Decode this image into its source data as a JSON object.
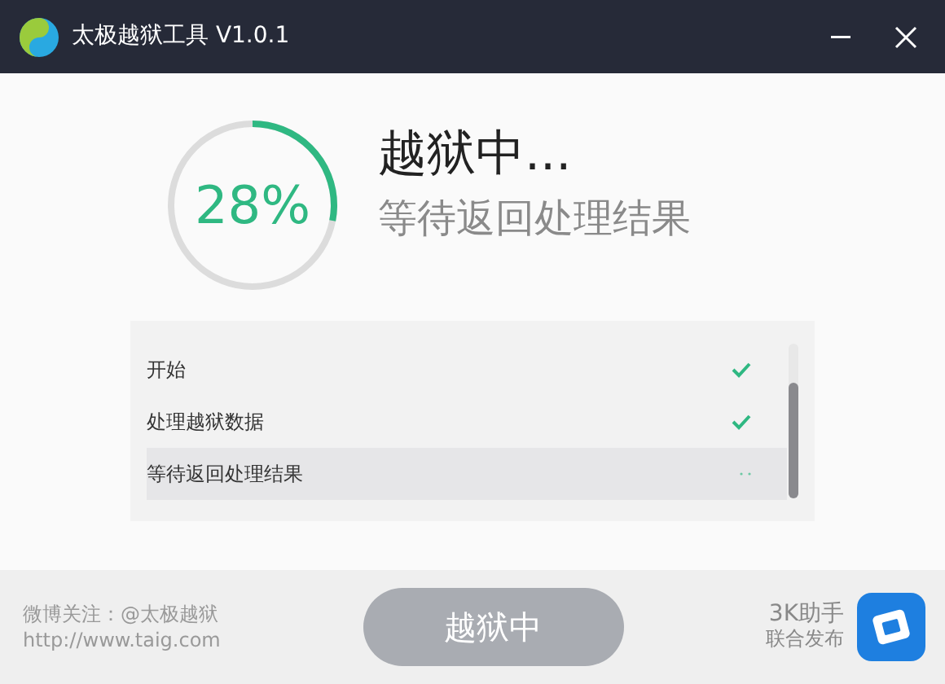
{
  "window": {
    "title": "太极越狱工具 V1.0.1"
  },
  "progress": {
    "level": 0.28,
    "reading": "28%"
  },
  "status": {
    "title": "越狱中...",
    "subtitle": "等待返回处理结果"
  },
  "steps": [
    {
      "label": "开始",
      "kind": "done",
      "selected": false
    },
    {
      "label": "处理越狱数据",
      "kind": "done",
      "selected": false
    },
    {
      "label": "等待返回处理结果",
      "kind": "working",
      "selected": true
    }
  ],
  "footer": {
    "weibo": "微博关注：@太极越狱",
    "url": "http://www.taig.com",
    "button": {
      "label": "越狱中",
      "disabled": true
    },
    "partner": "3K助手",
    "partner_note": "联合发布"
  }
}
